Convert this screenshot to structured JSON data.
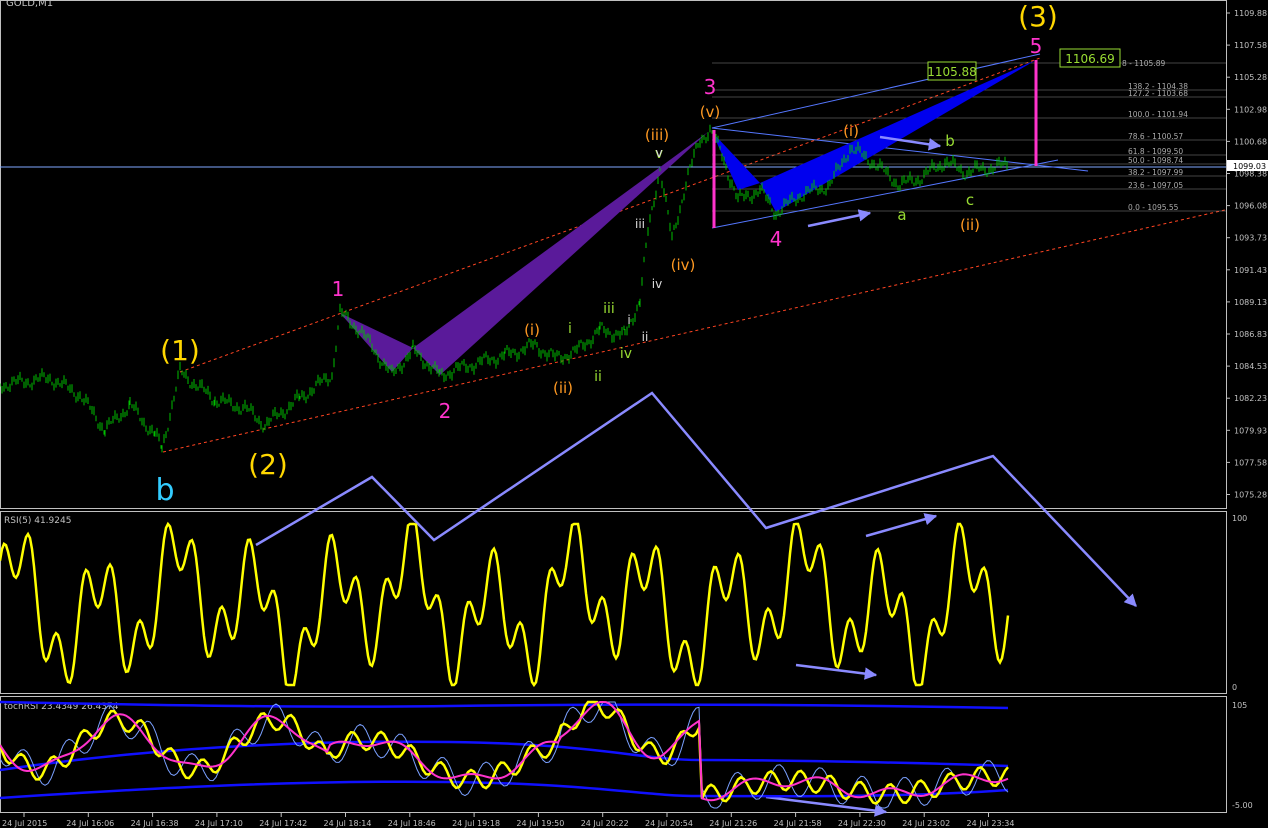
{
  "window": {
    "symbol_title": "GOLD,M1"
  },
  "colors": {
    "background": "#000000",
    "grid_frame": "#c0c0c0",
    "candles": "#00c000",
    "rsi_line": "#ffff00",
    "magenta_label": "#ff33cc",
    "orange_label": "#ff9922",
    "yellow_label": "#ffd700",
    "lime_label": "#99dd33",
    "cyan_label": "#33ccff",
    "blue_pattern": "#0000ee",
    "purple_pattern": "#5a1a9a",
    "arrow": "#8a8aff",
    "trend_channel": "#ff4422",
    "stoch_main": "#ffff00",
    "stoch_signal": "#ff33cc",
    "bands": "#1010ff"
  },
  "price_axis": {
    "ticks": [
      "1109.88",
      "1107.58",
      "1105.28",
      "1102.98",
      "1100.68",
      "1098.38",
      "1096.08",
      "1093.73",
      "1091.43",
      "1089.13",
      "1086.83",
      "1084.53",
      "1082.23",
      "1079.93",
      "1077.58",
      "1075.28"
    ],
    "current_price": "1099.03"
  },
  "time_axis": {
    "labels": [
      "24 Jul 2015",
      "24 Jul 16:06",
      "24 Jul 16:38",
      "24 Jul 17:10",
      "24 Jul 17:42",
      "24 Jul 18:14",
      "24 Jul 18:46",
      "24 Jul 19:18",
      "24 Jul 19:50",
      "24 Jul 20:22",
      "24 Jul 20:54",
      "24 Jul 21:26",
      "24 Jul 21:58",
      "24 Jul 22:30",
      "24 Jul 23:02",
      "24 Jul 23:34"
    ]
  },
  "fib_levels": [
    "138.2 - 1104.38",
    "127.2 - 1103.68",
    "100.0 - 1101.94",
    "78.6 - 1100.57",
    "61.8 - 1099.50",
    "50.0 - 1098.74",
    "38.2 - 1097.99",
    "23.6 - 1097.05",
    "0.0 - 1095.55"
  ],
  "fib_top_partial": "8 - 1105.89",
  "price_boxes": {
    "left": "1105.88",
    "right": "1106.69"
  },
  "wave_labels": {
    "big_1": "(1)",
    "big_2": "(2)",
    "big_3": "(3)",
    "b_cyan": "b",
    "m1": "1",
    "m2": "2",
    "m3": "3",
    "m4": "4",
    "m5": "5",
    "o_i": "(i)",
    "o_ii": "(ii)",
    "o_iii": "(iii)",
    "o_iv": "(iv)",
    "o_v": "(v)",
    "o_i2": "(i)",
    "o_ii2": "(ii)",
    "g_i": "i",
    "g_ii": "ii",
    "g_iii": "iii",
    "g_iv": "iv",
    "g_v": "v",
    "w_i": "i",
    "w_ii": "ii",
    "w_iii": "iii",
    "w_iv": "iv",
    "w_v": "v",
    "g_a": "a",
    "g_b": "b",
    "g_c": "c"
  },
  "rsi": {
    "title": "RSI(5) 41.9245",
    "max_label": "100",
    "min_label": "0"
  },
  "stoch": {
    "title": "tochRSI 23.4349 26.4374",
    "max_label": "105",
    "min_label": "-5.00"
  }
}
